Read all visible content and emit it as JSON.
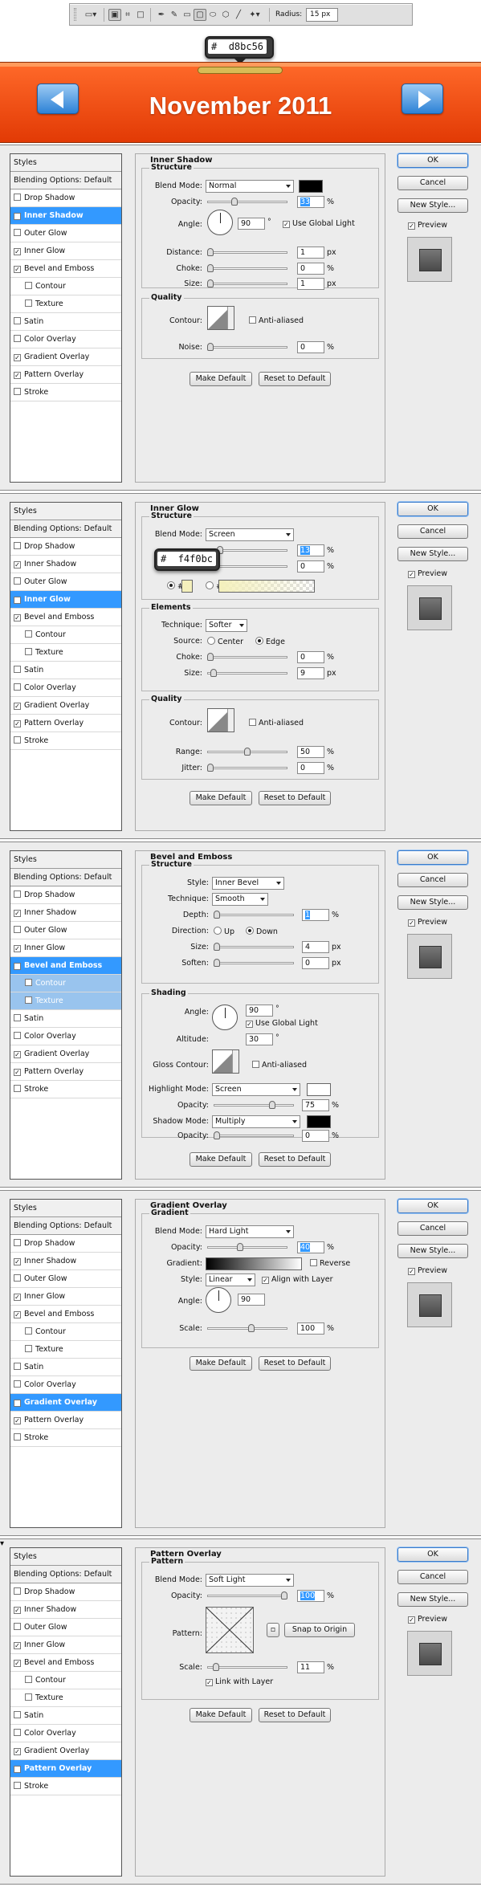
{
  "toolbar": {
    "radius_label": "Radius:",
    "radius_value": "15 px",
    "icons": [
      "rounded-rect-preset-icon",
      "shape-layers-icon",
      "paths-icon",
      "fill-pixels-icon",
      "pen-icon",
      "freeform-pen-icon",
      "rectangle-icon",
      "rounded-rectangle-icon",
      "ellipse-icon",
      "polygon-icon",
      "line-icon",
      "custom-shape-icon"
    ]
  },
  "color_tip_top": {
    "value": "d8bc56",
    "hash": "#"
  },
  "banner": {
    "title": "November 2011",
    "color_top": "#ff6a2a",
    "color_bottom": "#e23a05",
    "nav_color": "#2d82d6"
  },
  "buttons": {
    "ok": "OK",
    "cancel": "Cancel",
    "new_style": "New Style...",
    "preview": "Preview",
    "make_default": "Make Default",
    "reset_default": "Reset to Default"
  },
  "styles_list": {
    "header": "Styles",
    "blending": "Blending Options: Default",
    "items": [
      "Drop Shadow",
      "Inner Shadow",
      "Outer Glow",
      "Inner Glow",
      "Bevel and Emboss",
      "Contour",
      "Texture",
      "Satin",
      "Color Overlay",
      "Gradient Overlay",
      "Pattern Overlay",
      "Stroke"
    ]
  },
  "inner_shadow": {
    "title": "Inner Shadow",
    "structure": "Structure",
    "quality": "Quality",
    "blend_mode_label": "Blend Mode:",
    "blend_mode": "Normal",
    "color": "#000000",
    "opacity_label": "Opacity:",
    "opacity": "33",
    "opacity_unit": "%",
    "angle_label": "Angle:",
    "angle": "90",
    "angle_unit": "°",
    "global_light": "Use Global Light",
    "distance_label": "Distance:",
    "distance": "1",
    "choke_label": "Choke:",
    "choke": "0",
    "size_label": "Size:",
    "size": "1",
    "px": "px",
    "pct": "%",
    "contour_label": "Contour:",
    "anti_aliased": "Anti-aliased",
    "noise_label": "Noise:",
    "noise": "0"
  },
  "inner_glow": {
    "title": "Inner Glow",
    "structure": "Structure",
    "elements": "Elements",
    "quality": "Quality",
    "blend_mode_label": "Blend Mode:",
    "blend_mode": "Screen",
    "opacity": "13",
    "noise": "0",
    "tip_hash": "#",
    "tip_value": "f4f0bc",
    "glow_color": "#f4f0bc",
    "technique_label": "Technique:",
    "technique": "Softer",
    "source_label": "Source:",
    "center": "Center",
    "edge": "Edge",
    "choke_label": "Choke:",
    "choke": "0",
    "size_label": "Size:",
    "size": "9",
    "contour_label": "Contour:",
    "anti_aliased": "Anti-aliased",
    "range_label": "Range:",
    "range": "50",
    "jitter_label": "Jitter:",
    "jitter": "0",
    "pct": "%",
    "px": "px"
  },
  "bevel": {
    "title": "Bevel and Emboss",
    "structure": "Structure",
    "shading": "Shading",
    "style_label": "Style:",
    "style": "Inner Bevel",
    "technique_label": "Technique:",
    "technique": "Smooth",
    "depth_label": "Depth:",
    "depth": "1",
    "direction_label": "Direction:",
    "up": "Up",
    "down": "Down",
    "size_label": "Size:",
    "size": "4",
    "soften_label": "Soften:",
    "soften": "0",
    "angle_label": "Angle:",
    "angle": "90",
    "global_light": "Use Global Light",
    "altitude_label": "Altitude:",
    "altitude": "30",
    "gloss_label": "Gloss Contour:",
    "anti_aliased": "Anti-aliased",
    "highlight_label": "Highlight Mode:",
    "highlight_mode": "Screen",
    "highlight_color": "#ffffff",
    "h_opacity": "75",
    "shadow_label": "Shadow Mode:",
    "shadow_mode": "Multiply",
    "shadow_color": "#000000",
    "s_opacity": "0",
    "opacity_label": "Opacity:",
    "pct": "%",
    "px": "px",
    "deg": "°"
  },
  "gradient": {
    "title": "Gradient Overlay",
    "group": "Gradient",
    "blend_mode_label": "Blend Mode:",
    "blend_mode": "Hard Light",
    "opacity_label": "Opacity:",
    "opacity": "40",
    "gradient_label": "Gradient:",
    "reverse": "Reverse",
    "style_label": "Style:",
    "style": "Linear",
    "align": "Align with Layer",
    "angle_label": "Angle:",
    "angle": "90",
    "scale_label": "Scale:",
    "scale": "100",
    "pct": "%"
  },
  "pattern": {
    "title": "Pattern Overlay",
    "group": "Pattern",
    "blend_mode_label": "Blend Mode:",
    "blend_mode": "Soft Light",
    "opacity_label": "Opacity:",
    "opacity": "100",
    "pattern_label": "Pattern:",
    "snap": "Snap to Origin",
    "scale_label": "Scale:",
    "scale": "11",
    "link": "Link with Layer",
    "pct": "%"
  }
}
